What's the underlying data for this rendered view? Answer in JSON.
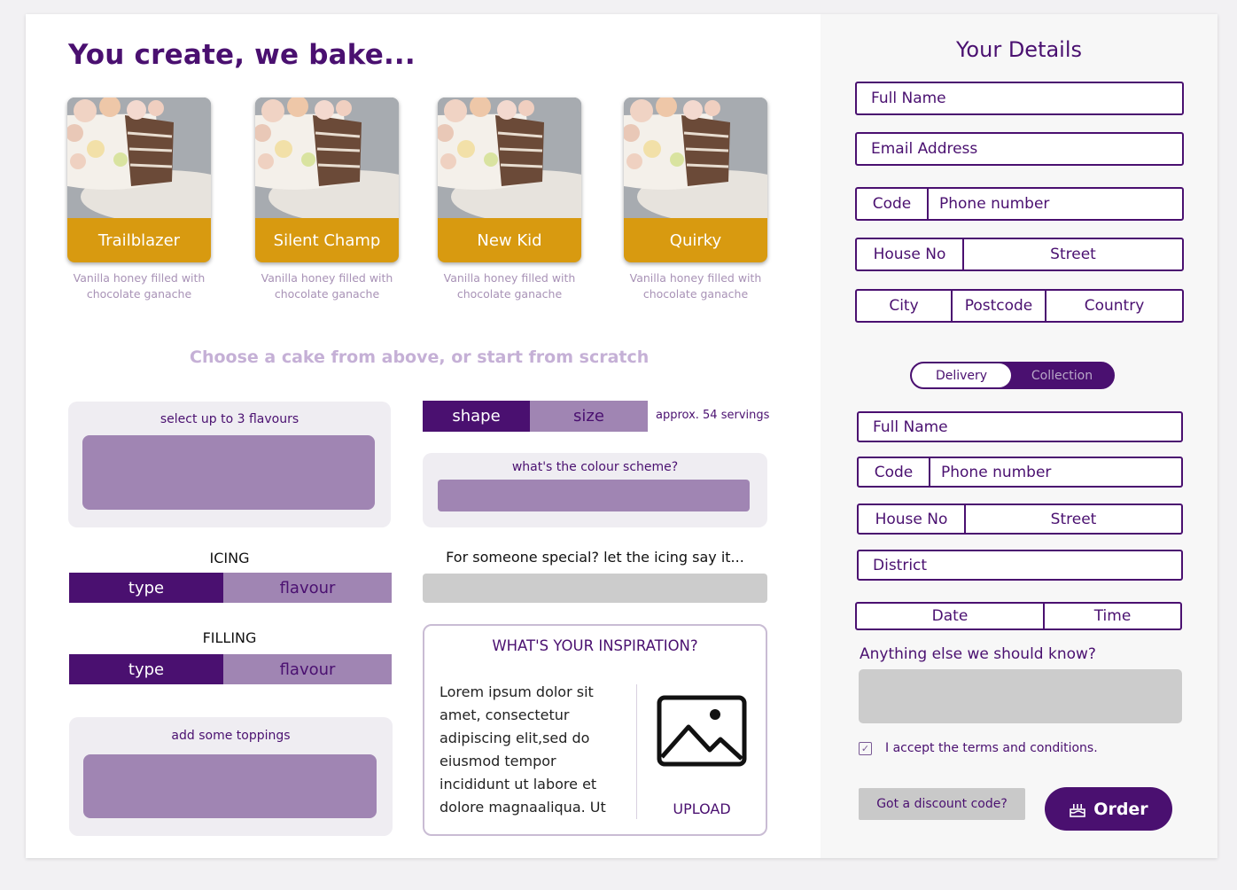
{
  "header": {
    "title": "You create, we bake..."
  },
  "cakes": [
    {
      "name": "Trailblazer",
      "description": "Vanilla honey filled with chocolate ganache"
    },
    {
      "name": "Silent Champ",
      "description": "Vanilla honey filled with chocolate ganache"
    },
    {
      "name": "New Kid",
      "description": "Vanilla honey filled with chocolate ganache"
    },
    {
      "name": "Quirky",
      "description": "Vanilla honey filled with chocolate ganache"
    }
  ],
  "choose_text": "Choose a cake from above, or start from scratch",
  "flavours": {
    "label": "select up to 3 flavours"
  },
  "shape_size": {
    "shape_label": "shape",
    "size_label": "size",
    "servings": "approx. 54 servings"
  },
  "colour_scheme": {
    "label": "what's the colour scheme?"
  },
  "icing": {
    "heading": "ICING",
    "type_label": "type",
    "flavour_label": "flavour"
  },
  "message": {
    "heading": "For someone special? let the icing say it..."
  },
  "filling": {
    "heading": "FILLING",
    "type_label": "type",
    "flavour_label": "flavour"
  },
  "toppings": {
    "label": "add some toppings"
  },
  "inspiration": {
    "heading": "WHAT'S YOUR INSPIRATION?",
    "body": "Lorem ipsum dolor sit amet, consectetur adipiscing elit,sed do eiusmod tempor incididunt ut labore et dolore magnaaliqua. Ut",
    "upload_label": "UPLOAD",
    "upload_icon": "image-icon"
  },
  "details": {
    "title": "Your Details",
    "full_name": "Full Name",
    "email": "Email Address",
    "code": "Code",
    "phone": "Phone number",
    "house_no": "House No",
    "street": "Street",
    "city": "City",
    "postcode": "Postcode",
    "country": "Country"
  },
  "delivery_toggle": {
    "delivery": "Delivery",
    "collection": "Collection",
    "selected": "Delivery"
  },
  "delivery": {
    "full_name": "Full Name",
    "code": "Code",
    "phone": "Phone number",
    "house_no": "House No",
    "street": "Street",
    "district": "District",
    "date": "Date",
    "time": "Time"
  },
  "notes": {
    "label": "Anything else we should know?"
  },
  "terms": {
    "label": "I accept the terms and conditions.",
    "checked": true
  },
  "actions": {
    "discount_label": "Got a discount code?",
    "order_label": "Order",
    "order_icon": "cake-icon"
  },
  "colors": {
    "brand": "#4a1070",
    "accent": "#d89a10",
    "muted": "#a085b3"
  }
}
